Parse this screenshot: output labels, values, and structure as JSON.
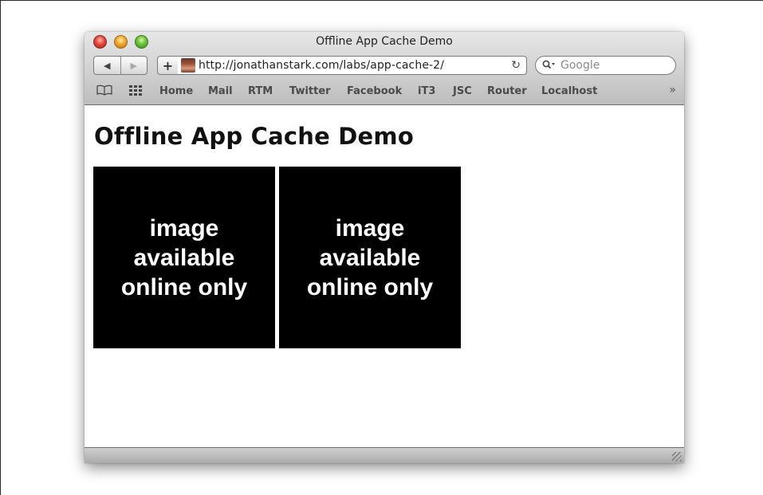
{
  "window": {
    "title": "Offline App Cache Demo"
  },
  "toolbar": {
    "back_icon": "◀",
    "forward_icon": "▶",
    "add_icon": "+",
    "url": "http://jonathanstark.com/labs/app-cache-2/",
    "reload_icon": "↻",
    "search_placeholder": "Google"
  },
  "bookmarks": {
    "items": [
      "Home",
      "Mail",
      "RTM",
      "Twitter",
      "Facebook",
      "iT3",
      "JSC",
      "Router",
      "Localhost"
    ],
    "overflow_icon": "»"
  },
  "page": {
    "heading": "Offline App Cache Demo",
    "images": [
      {
        "text": "image available online only"
      },
      {
        "text": "image available online only"
      }
    ]
  }
}
